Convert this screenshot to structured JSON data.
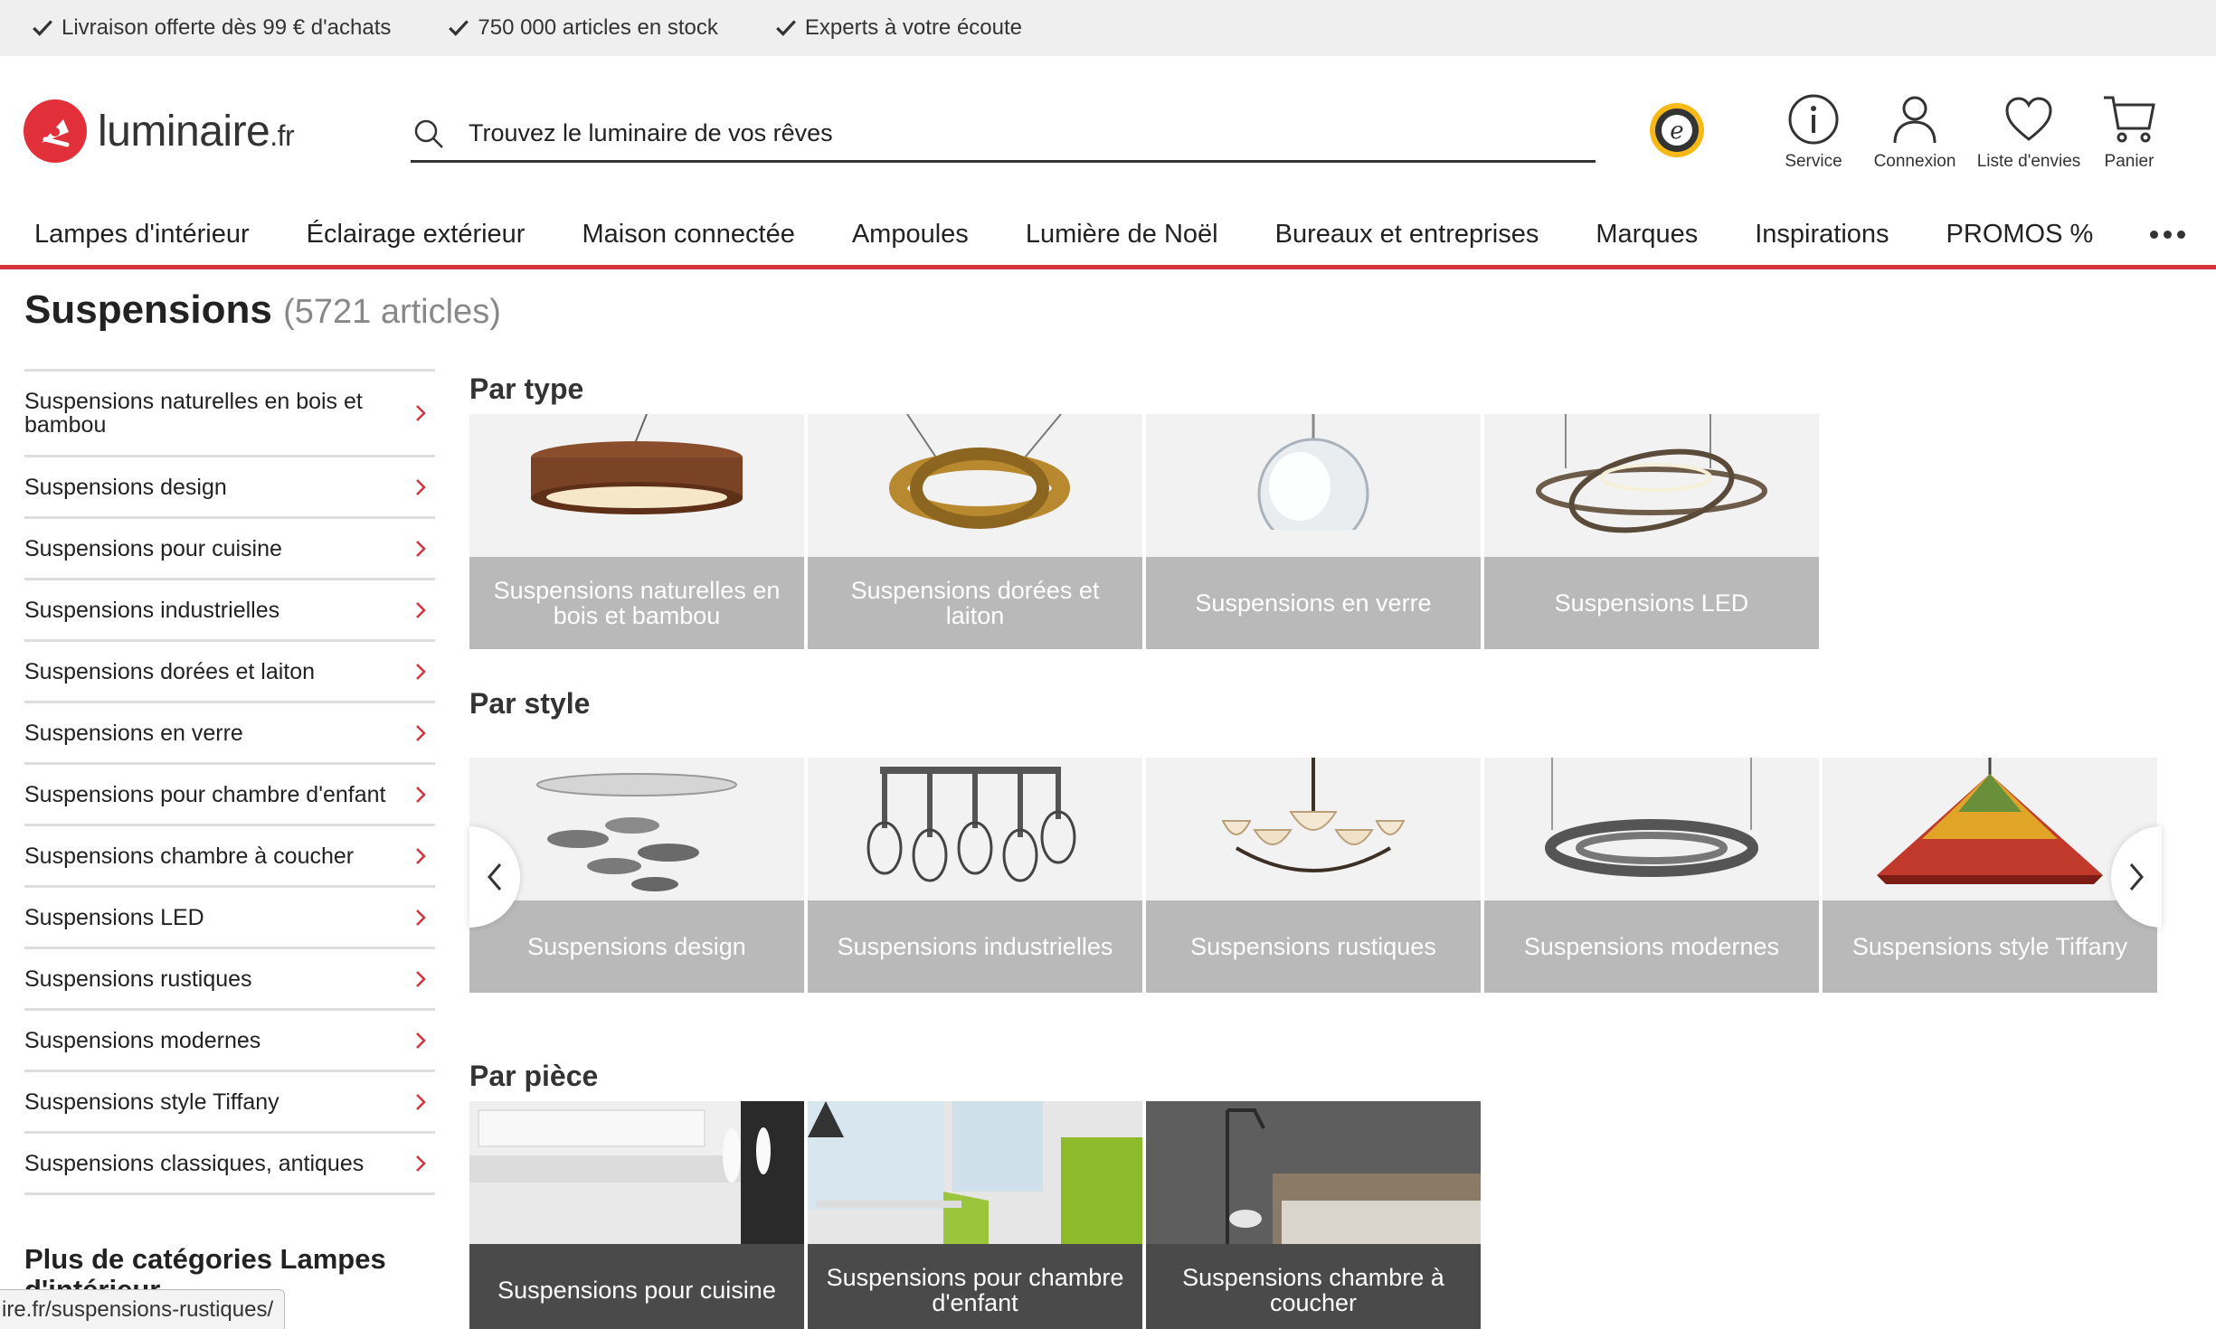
{
  "topbar": {
    "usps": [
      "Livraison offerte dès 99 € d'achats",
      "750 000 articles en stock",
      "Experts à votre écoute"
    ]
  },
  "header": {
    "logo_name": "luminaire",
    "logo_tld": ".fr",
    "search_placeholder": "Trouvez le luminaire de vos rêves",
    "service_label": "Service",
    "login_label": "Connexion",
    "wishlist_label": "Liste d'envies",
    "cart_label": "Panier"
  },
  "nav": {
    "items": [
      "Lampes d'intérieur",
      "Éclairage extérieur",
      "Maison connectée",
      "Ampoules",
      "Lumière de Noël",
      "Bureaux et entreprises",
      "Marques",
      "Inspirations",
      "PROMOS %"
    ]
  },
  "page": {
    "title": "Suspensions",
    "count": "(5721 articles)"
  },
  "sidebar": {
    "items": [
      "Suspensions naturelles en bois et bambou",
      "Suspensions design",
      "Suspensions pour cuisine",
      "Suspensions industrielles",
      "Suspensions dorées et laiton",
      "Suspensions en verre",
      "Suspensions pour chambre d'enfant",
      "Suspensions chambre à coucher",
      "Suspensions LED",
      "Suspensions rustiques",
      "Suspensions modernes",
      "Suspensions style Tiffany",
      "Suspensions classiques, antiques"
    ],
    "more_title": "Plus de catégories Lampes d'intérieur"
  },
  "sections": {
    "type": {
      "title": "Par type",
      "tiles": [
        "Suspensions naturelles en bois et bambou",
        "Suspensions dorées et laiton",
        "Suspensions en verre",
        "Suspensions LED"
      ]
    },
    "style": {
      "title": "Par style",
      "tiles": [
        "Suspensions design",
        "Suspensions industrielles",
        "Suspensions rustiques",
        "Suspensions modernes",
        "Suspensions style Tiffany"
      ]
    },
    "room": {
      "title": "Par pièce",
      "tiles": [
        "Suspensions pour cuisine",
        "Suspensions pour chambre d'enfant",
        "Suspensions chambre à coucher"
      ]
    }
  },
  "status_url": "ire.fr/suspensions-rustiques/",
  "colors": {
    "brand_red": "#d6323b",
    "tile_caption": "#b9b9b9",
    "tile_caption_dark": "#4a4a4a"
  },
  "icons": [
    "check-icon",
    "search-icon",
    "trusted-shops-badge",
    "info-icon",
    "user-icon",
    "heart-icon",
    "cart-icon",
    "chevron-right-icon",
    "chevron-left-icon",
    "more-dots-icon"
  ]
}
